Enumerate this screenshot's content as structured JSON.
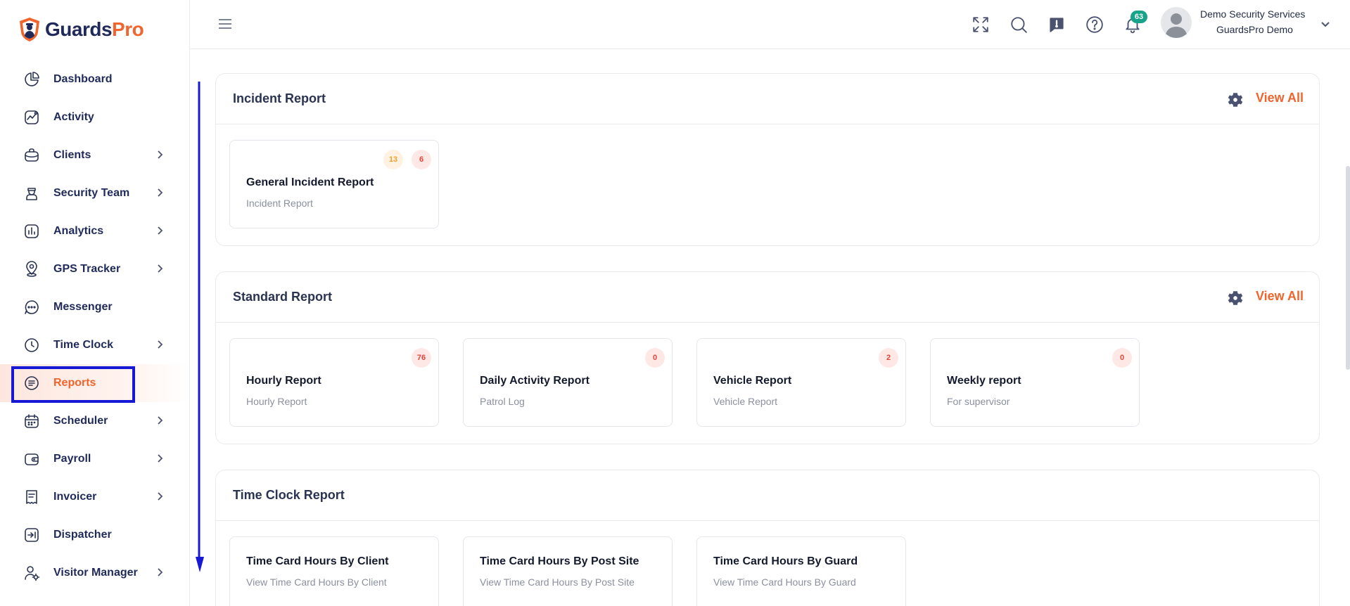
{
  "brand": {
    "name_part1": "Guards",
    "name_part2": "Pro"
  },
  "sidebar": {
    "items": [
      {
        "label": "Dashboard",
        "icon": "pie-chart-icon",
        "has_chevron": false
      },
      {
        "label": "Activity",
        "icon": "activity-icon",
        "has_chevron": false
      },
      {
        "label": "Clients",
        "icon": "briefcase-icon",
        "has_chevron": true
      },
      {
        "label": "Security Team",
        "icon": "guard-icon",
        "has_chevron": true
      },
      {
        "label": "Analytics",
        "icon": "analytics-icon",
        "has_chevron": true
      },
      {
        "label": "GPS Tracker",
        "icon": "map-pin-icon",
        "has_chevron": true
      },
      {
        "label": "Messenger",
        "icon": "chat-icon",
        "has_chevron": false
      },
      {
        "label": "Time Clock",
        "icon": "clock-icon",
        "has_chevron": true
      },
      {
        "label": "Reports",
        "icon": "reports-icon",
        "has_chevron": false,
        "active": true
      },
      {
        "label": "Scheduler",
        "icon": "calendar-icon",
        "has_chevron": true
      },
      {
        "label": "Payroll",
        "icon": "wallet-icon",
        "has_chevron": true
      },
      {
        "label": "Invoicer",
        "icon": "invoice-icon",
        "has_chevron": true
      },
      {
        "label": "Dispatcher",
        "icon": "dispatch-icon",
        "has_chevron": false
      },
      {
        "label": "Visitor Manager",
        "icon": "visitor-icon",
        "has_chevron": true
      }
    ]
  },
  "header": {
    "notification_count": "63",
    "user_name": "Demo Security Services",
    "user_company": "GuardsPro Demo"
  },
  "sections": {
    "incident": {
      "title": "Incident Report",
      "view_all": "View All",
      "cards": [
        {
          "title": "General Incident Report",
          "subtitle": "Incident Report",
          "badge_orange": "13",
          "badge_red": "6"
        }
      ]
    },
    "standard": {
      "title": "Standard Report",
      "view_all": "View All",
      "cards": [
        {
          "title": "Hourly Report",
          "subtitle": "Hourly Report",
          "badge_red": "76"
        },
        {
          "title": "Daily Activity Report",
          "subtitle": "Patrol Log",
          "badge_red": "0"
        },
        {
          "title": "Vehicle Report",
          "subtitle": "Vehicle Report",
          "badge_red": "2"
        },
        {
          "title": "Weekly report",
          "subtitle": "For supervisor",
          "badge_red": "0"
        }
      ]
    },
    "timeclock": {
      "title": "Time Clock Report",
      "cards": [
        {
          "title": "Time Card Hours By Client",
          "subtitle": "View Time Card Hours By Client"
        },
        {
          "title": "Time Card Hours By Post Site",
          "subtitle": "View Time Card Hours By Post Site"
        },
        {
          "title": "Time Card Hours By Guard",
          "subtitle": "View Time Card Hours By Guard"
        }
      ]
    }
  },
  "colors": {
    "accent": "#f0642d",
    "navy": "#1f2a5a",
    "highlight": "#1717d6",
    "teal": "#16a38a"
  }
}
